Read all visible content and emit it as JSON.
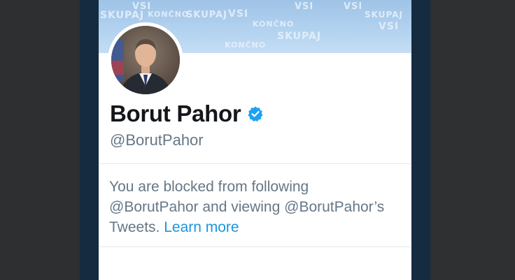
{
  "profile": {
    "name": "Borut Pahor",
    "handle": "@BorutPahor",
    "verified": true
  },
  "banner": {
    "words": [
      "VSI",
      "SKUPAJ",
      "KONČNO",
      "VSI",
      "SKUPAJ",
      "VSI",
      "KONČNO",
      "SKUPAJ",
      "VSI",
      "KONČNO",
      "VSI",
      "SKUPAJ"
    ]
  },
  "notice": {
    "line1": "You are blocked from following",
    "line2": "@BorutPahor and viewing @BorutPahor’s",
    "line3_prefix": "Tweets.",
    "learn_more": "Learn more"
  },
  "colors": {
    "verified_badge": "#1da1f2",
    "link": "#1b95e0",
    "muted_text": "#657786",
    "frame": "#142b40"
  }
}
